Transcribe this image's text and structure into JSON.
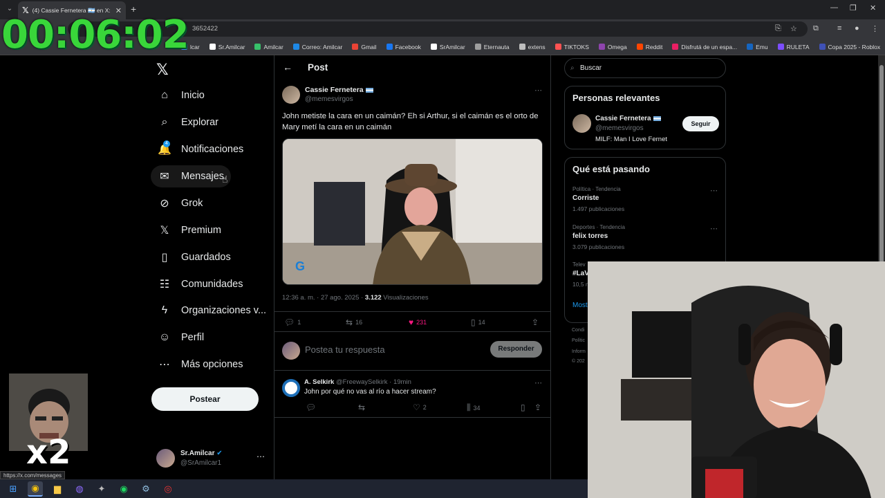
{
  "browser": {
    "tab_title": "(4) Cassie Fernetera 🇦🇷 en X: \"Jo",
    "url_fragment": "3652422",
    "status_url": "https://x.com/messages",
    "bookmarks": [
      "lcar",
      "Sr.Amilcar",
      "Amilcar",
      "Correo: Amilcar",
      "Gmail",
      "Facebook",
      "SrAmilcar",
      "Eternauta",
      "extens",
      "TIKTOKS",
      "Omega",
      "Reddit",
      "Disfrutá de un espa...",
      "Emu",
      "RULETA",
      "Copa 2025 - Roblox"
    ],
    "bookmark_colors": [
      "#4285f4",
      "#ffffff",
      "#37c16a",
      "#1e88e5",
      "#ea4335",
      "#1877f2",
      "#ffffff",
      "#9e9e9e",
      "#bdbdbd",
      "#ff5252",
      "#8e44ad",
      "#ff4500",
      "#e91e63",
      "#1565c0",
      "#7c4dff",
      "#3f51b5"
    ]
  },
  "overlay": {
    "timer": "00:06:02",
    "multiplier": "x2"
  },
  "nav": {
    "items": [
      {
        "label": "Inicio",
        "icon": "⌂"
      },
      {
        "label": "Explorar",
        "icon": "⌕"
      },
      {
        "label": "Notificaciones",
        "icon": "🔔"
      },
      {
        "label": "Mensajes",
        "icon": "✉"
      },
      {
        "label": "Grok",
        "icon": "⊘"
      },
      {
        "label": "Premium",
        "icon": "𝕏"
      },
      {
        "label": "Guardados",
        "icon": "▯"
      },
      {
        "label": "Comunidades",
        "icon": "☷"
      },
      {
        "label": "Organizaciones v...",
        "icon": "ϟ"
      },
      {
        "label": "Perfil",
        "icon": "☺"
      },
      {
        "label": "Más opciones",
        "icon": "⋯"
      }
    ],
    "notif_badge": "4",
    "post_label": "Postear",
    "account_name": "Sr.Amilcar",
    "account_handle": "@SrAmilcar1"
  },
  "post": {
    "header": "Post",
    "author_name": "Cassie Fernetera",
    "author_handle": "@memesvirgos",
    "text": "John metiste la cara en un caimán? Eh si Arthur, si el caimán es el orto de Mary metí la cara en un caimán",
    "timestamp": "12:36 a. m. · 27 ago. 2025 · ",
    "views": "3.122",
    "views_label": " Visualizaciones",
    "replies": "1",
    "reposts": "16",
    "likes": "231",
    "bookmarks": "14",
    "reply_placeholder": "Postea tu respuesta",
    "reply_button": "Responder"
  },
  "reply": {
    "name": "A. Selkirk",
    "handle": "@FreewaySelkirk · 19min",
    "text": "John por qué no vas al río a hacer stream?",
    "reposts": "",
    "likes": "2",
    "views": "34"
  },
  "sidebar": {
    "search_placeholder": "Buscar",
    "relevant_title": "Personas relevantes",
    "rel_name": "Cassie Fernetera",
    "rel_handle": "@memesvirgos",
    "rel_bio": "MILF: Man I Love Fernet",
    "follow_label": "Seguir",
    "trending_title": "Qué está pasando",
    "trends": [
      {
        "category": "Política · Tendencia",
        "name": "Corriste",
        "count": "1.497 publicaciones"
      },
      {
        "category": "Deportes · Tendencia",
        "name": "felix torres",
        "count": "3.079 publicaciones"
      },
      {
        "category": "Telev",
        "name": "#LaV",
        "count": "10,5 n"
      }
    ],
    "show_more": "Most",
    "footer": [
      "Condi",
      "Polític",
      "Inform",
      "© 202"
    ]
  }
}
